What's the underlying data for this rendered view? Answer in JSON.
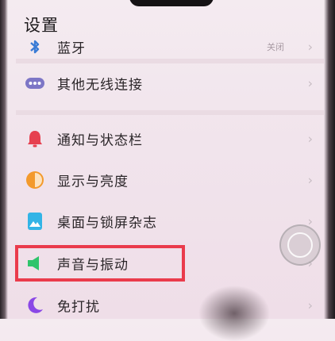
{
  "header": {
    "title": "设置"
  },
  "settings": {
    "items": [
      {
        "id": "bluetooth",
        "label": "蓝牙",
        "icon": "bluetooth-icon",
        "trail": "关闭"
      },
      {
        "id": "other-wireless",
        "label": "其他无线连接",
        "icon": "ellipsis-icon"
      },
      {
        "id": "notifications",
        "label": "通知与状态栏",
        "icon": "bell-icon"
      },
      {
        "id": "display",
        "label": "显示与亮度",
        "icon": "brightness-icon"
      },
      {
        "id": "wallpaper",
        "label": "桌面与锁屏杂志",
        "icon": "wallpaper-icon"
      },
      {
        "id": "sound",
        "label": "声音与振动",
        "icon": "speaker-icon"
      },
      {
        "id": "dnd",
        "label": "免打扰",
        "icon": "moon-icon"
      }
    ],
    "chevron": "›"
  },
  "colors": {
    "highlight": "#ea3b4c",
    "bell": "#e6404f",
    "display": "#f39a2c",
    "wallpaper": "#33b4e6",
    "sound": "#2fc46b",
    "moon": "#8a47e6",
    "wireless": "#7d76c6"
  }
}
